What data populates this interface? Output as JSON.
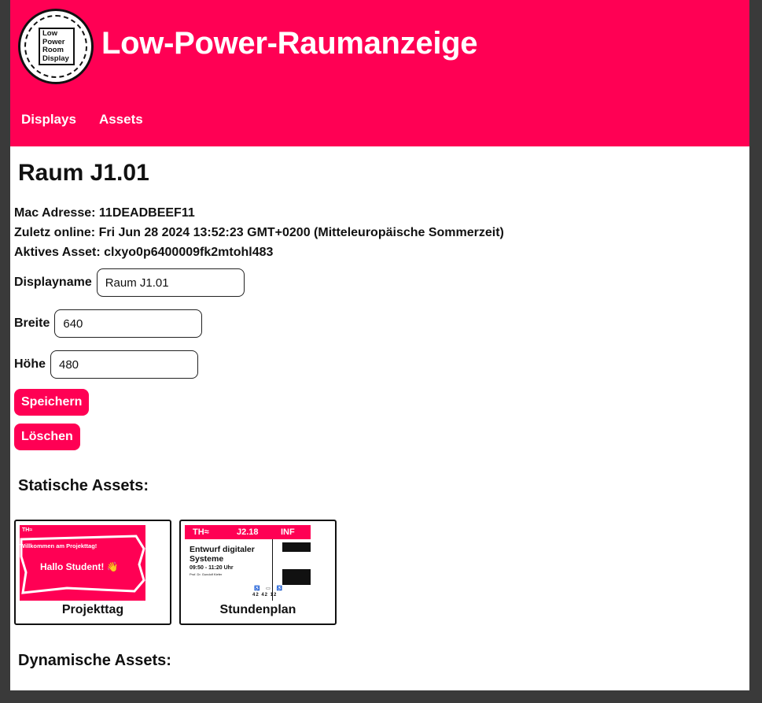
{
  "app": {
    "title": "Low-Power-Raumanzeige",
    "logo_lines": [
      "Low",
      "Power",
      "Room",
      "Display"
    ],
    "accent": "#ff0054"
  },
  "nav": {
    "items": [
      {
        "label": "Displays"
      },
      {
        "label": "Assets"
      }
    ]
  },
  "room": {
    "title": "Raum J1.01",
    "mac_label": "Mac Adresse:",
    "mac_value": "11DEADBEEF11",
    "online_label": "Zuletz online:",
    "online_value": "Fri Jun 28 2024 13:52:23 GMT+0200 (Mitteleuropäische Sommerzeit)",
    "asset_label": "Aktives Asset:",
    "asset_value": "clxyo0p6400009fk2mtohl483"
  },
  "form": {
    "displayname_label": "Displayname",
    "displayname_value": "Raum J1.01",
    "width_label": "Breite",
    "width_value": "640",
    "height_label": "Höhe",
    "height_value": "480",
    "save_label": "Speichern",
    "delete_label": "Löschen"
  },
  "static_assets": {
    "heading": "Statische Assets:",
    "items": [
      {
        "label": "Projekttag",
        "thumb": {
          "logo": "TH≈",
          "welcome": "Willkommen am Projekttag!",
          "hello": "Hallo Student! 👋"
        }
      },
      {
        "label": "Stundenplan",
        "thumb": {
          "logo": "TH≈",
          "room": "J2.18",
          "dept": "INF",
          "lecture": "Entwurf digitaler Systeme",
          "time": "09:50 - 11:20 Uhr",
          "prof": "Prof. Dr. Gundolf Kiefer",
          "counts": "42 42 12"
        }
      }
    ]
  },
  "dynamic_assets": {
    "heading": "Dynamische Assets:"
  }
}
